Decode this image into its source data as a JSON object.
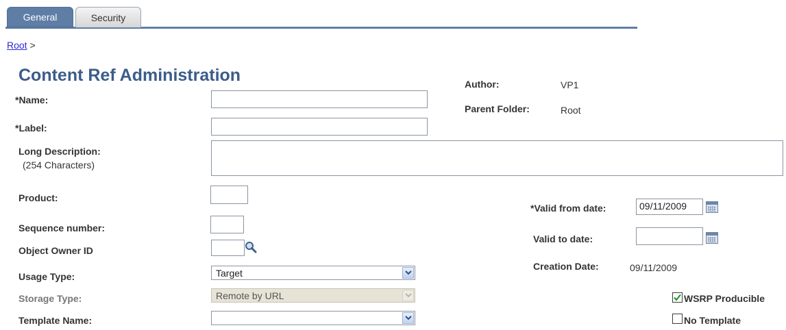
{
  "tabs": [
    {
      "label": "General"
    },
    {
      "label": "Security"
    }
  ],
  "breadcrumb": {
    "link": "Root",
    "separator": ">"
  },
  "page_title": "Content Ref Administration",
  "info": {
    "author_label": "Author:",
    "author_value": "VP1",
    "parent_folder_label": "Parent Folder:",
    "parent_folder_value": "Root"
  },
  "form": {
    "name_label": "*Name:",
    "name_value": "",
    "label_label": "*Label:",
    "label_value": "",
    "long_desc_label": "Long Description:",
    "long_desc_sublabel": "(254 Characters)",
    "long_desc_value": "",
    "product_label": "Product:",
    "product_value": "",
    "sequence_label": "Sequence number:",
    "sequence_value": "",
    "owner_label": "Object Owner ID",
    "owner_value": "",
    "usage_label": "Usage Type:",
    "usage_value": "Target",
    "storage_label": "Storage Type:",
    "storage_value": "Remote by URL",
    "template_label": "Template Name:",
    "template_value": ""
  },
  "dates": {
    "valid_from_label": "*Valid from date:",
    "valid_from_value": "09/11/2009",
    "valid_to_label": "Valid to date:",
    "valid_to_value": "",
    "creation_label": "Creation Date:",
    "creation_value": "09/11/2009"
  },
  "options": {
    "wsrp_label": "WSRP Producible",
    "wsrp_checked": true,
    "no_template_label": "No Template",
    "no_template_checked": false
  },
  "colors": {
    "accent": "#5f7ea6",
    "title": "#3c5c8a",
    "link": "#2a2ad6"
  }
}
